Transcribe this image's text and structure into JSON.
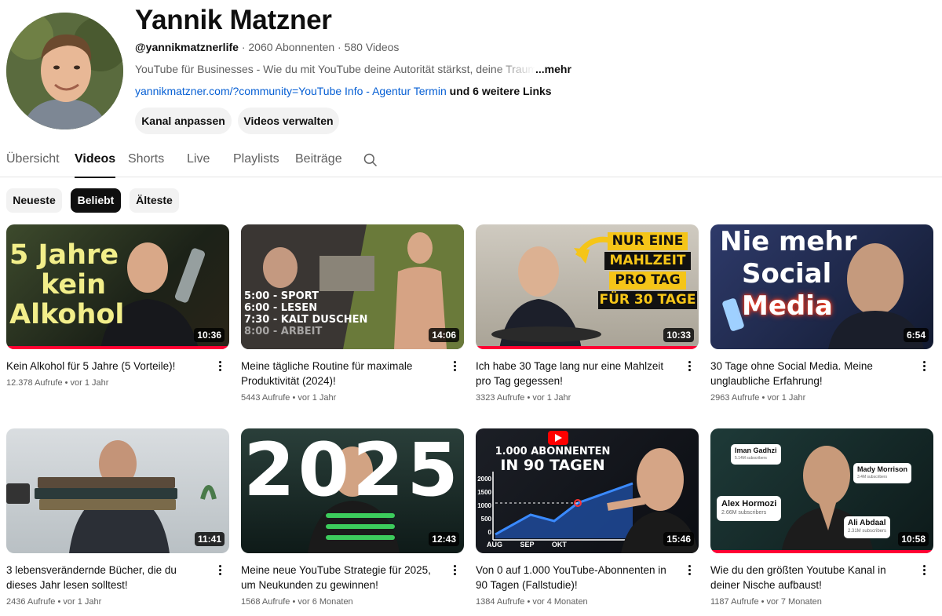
{
  "channel": {
    "name": "Yannik Matzner",
    "handle": "@yannikmatznerlife",
    "subscribers": "2060 Abonnenten",
    "video_count": "580 Videos",
    "separator": "·",
    "description": "YouTube für Businesses - Wie du mit YouTube deine Autorität stärkst, deine Traumkunden",
    "description_more": "...mehr",
    "link": "yannikmatzner.com/?community=YouTube Info - Agentur Termin",
    "more_links": "und 6 weitere Links"
  },
  "buttons": {
    "customize": "Kanal anpassen",
    "manage": "Videos verwalten"
  },
  "tabs": [
    {
      "label": "Übersicht"
    },
    {
      "label": "Videos"
    },
    {
      "label": "Shorts"
    },
    {
      "label": "Live"
    },
    {
      "label": "Playlists"
    },
    {
      "label": "Beiträge"
    }
  ],
  "active_tab": "Videos",
  "chips": [
    {
      "label": "Neueste",
      "selected": false
    },
    {
      "label": "Beliebt",
      "selected": true
    },
    {
      "label": "Älteste",
      "selected": false
    }
  ],
  "videos": [
    {
      "title": "Kein Alkohol für 5 Jahre (5 Vorteile)!",
      "views": "12.378 Aufrufe",
      "age": "vor 1 Jahr",
      "duration": "10:36",
      "watched": 1.0,
      "thumb_text": [
        "5 Jahre",
        "kein",
        "Alkohol"
      ]
    },
    {
      "title": "Meine tägliche Routine für maximale Produktivität (2024)!",
      "views": "5443 Aufrufe",
      "age": "vor 1 Jahr",
      "duration": "14:06",
      "watched": 0.0,
      "thumb_text": [
        "5:00 - SPORT",
        "6:00 - LESEN",
        "7:30 - KALT DUSCHEN",
        "8:00 - ARBEIT"
      ]
    },
    {
      "title": "Ich habe 30 Tage lang nur eine Mahlzeit pro Tag gegessen!",
      "views": "3323 Aufrufe",
      "age": "vor 1 Jahr",
      "duration": "10:33",
      "watched": 1.0,
      "thumb_text": [
        "NUR EINE",
        "MAHLZEIT",
        "PRO TAG",
        "FÜR 30 TAGE"
      ]
    },
    {
      "title": "30 Tage ohne Social Media. Meine unglaubliche Erfahrung!",
      "views": "2963 Aufrufe",
      "age": "vor 1 Jahr",
      "duration": "6:54",
      "watched": 0.0,
      "thumb_text": [
        "Nie mehr",
        "Social",
        "Media"
      ]
    },
    {
      "title": "3 lebensverändernde Bücher, die du dieses Jahr lesen solltest!",
      "views": "2436 Aufrufe",
      "age": "vor 1 Jahr",
      "duration": "11:41",
      "watched": 0.0,
      "thumb_text": []
    },
    {
      "title": "Meine neue YouTube Strategie für 2025, um Neukunden zu gewinnen!",
      "views": "1568 Aufrufe",
      "age": "vor 6 Monaten",
      "duration": "12:43",
      "watched": 0.0,
      "thumb_text": [
        "2025"
      ]
    },
    {
      "title": "Von 0 auf 1.000 YouTube-Abonnenten in 90 Tagen (Fallstudie)!",
      "views": "1384 Aufrufe",
      "age": "vor 4 Monaten",
      "duration": "15:46",
      "watched": 0.0,
      "thumb_text": [
        "1.000 ABONNENTEN",
        "IN 90 TAGEN",
        "2000",
        "1500",
        "1000",
        "500",
        "0",
        "AUG",
        "SEP",
        "OKT"
      ]
    },
    {
      "title": "Wie du den größten Youtube Kanal in deiner Nische aufbaust!",
      "views": "1187 Aufrufe",
      "age": "vor 7 Monaten",
      "duration": "10:58",
      "watched": 1.0,
      "thumb_text": [
        "Iman Gadhzi",
        "5.14M subscribers",
        "Mady Morrison",
        "3.4M subscribers",
        "Alex Hormozi",
        "2.66M subscribers",
        "Ali Abdaal",
        "2.31M subscribers"
      ]
    }
  ],
  "colors": {
    "link": "#065fd4",
    "progress": "#ff0033",
    "chip_selected": "#0f0f0f"
  }
}
